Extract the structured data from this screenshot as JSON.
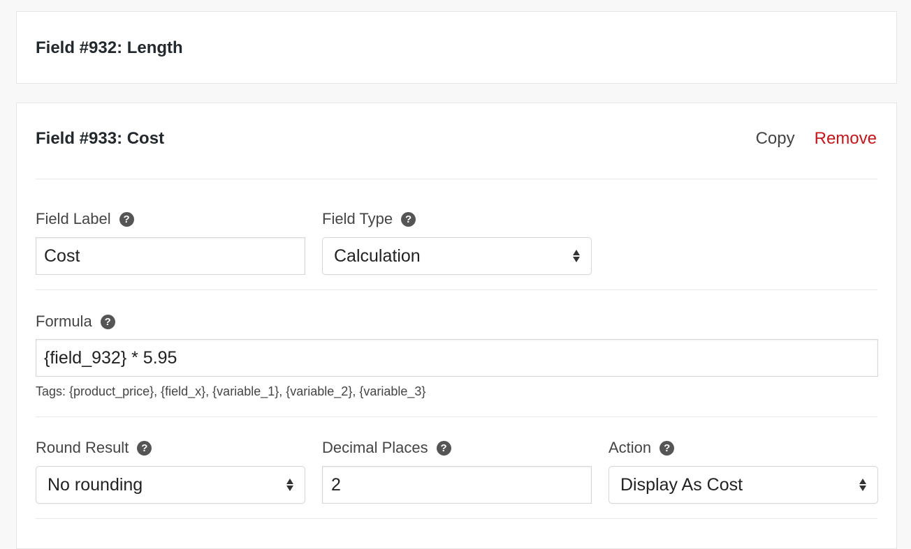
{
  "fields": [
    {
      "title": "Field #932: Length"
    },
    {
      "title": "Field #933: Cost",
      "actions": {
        "copy_label": "Copy",
        "remove_label": "Remove"
      },
      "field_label": {
        "label": "Field Label",
        "value": "Cost"
      },
      "field_type": {
        "label": "Field Type",
        "selected": "Calculation"
      },
      "formula": {
        "label": "Formula",
        "value": "{field_932} * 5.95",
        "tags_text": "Tags: {product_price}, {field_x}, {variable_1}, {variable_2}, {variable_3}"
      },
      "round_result": {
        "label": "Round Result",
        "selected": "No rounding"
      },
      "decimal_places": {
        "label": "Decimal Places",
        "value": "2"
      },
      "action": {
        "label": "Action",
        "selected": "Display As Cost"
      }
    }
  ],
  "icons": {
    "help": "?"
  },
  "colors": {
    "remove": "#c3161b",
    "background": "#f8f8f8"
  }
}
